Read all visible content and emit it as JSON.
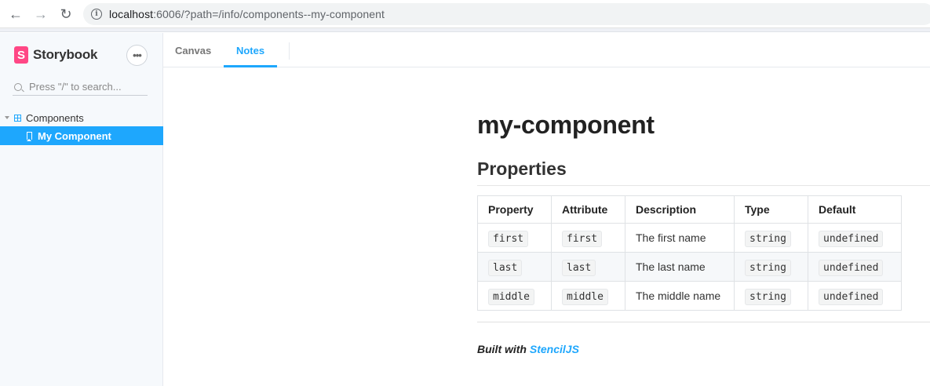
{
  "browser": {
    "url_host": "localhost",
    "url_path": ":6006/?path=/info/components--my-component",
    "back_glyph": "←",
    "forward_glyph": "→",
    "reload_glyph": "↻",
    "info_glyph": "i"
  },
  "sidebar": {
    "brand_logo": "S",
    "brand_name": "Storybook",
    "menu_glyph": "•••",
    "search_placeholder": "Press \"/\" to search...",
    "tree": {
      "group_label": "Components",
      "items": [
        {
          "label": "My Component",
          "selected": true
        }
      ]
    }
  },
  "tabs": [
    {
      "label": "Canvas",
      "active": false
    },
    {
      "label": "Notes",
      "active": true
    }
  ],
  "doc": {
    "title": "my-component",
    "section_title": "Properties",
    "table": {
      "headers": [
        "Property",
        "Attribute",
        "Description",
        "Type",
        "Default"
      ],
      "rows": [
        {
          "property": "first",
          "attribute": "first",
          "description": "The first name",
          "type": "string",
          "default": "undefined"
        },
        {
          "property": "last",
          "attribute": "last",
          "description": "The last name",
          "type": "string",
          "default": "undefined"
        },
        {
          "property": "middle",
          "attribute": "middle",
          "description": "The middle name",
          "type": "string",
          "default": "undefined"
        }
      ]
    },
    "footer_prefix": "Built with ",
    "footer_link": "StencilJS"
  },
  "colors": {
    "accent": "#1ea7fd",
    "brand": "#ff4785",
    "sidebar_bg": "#f6f9fc"
  }
}
